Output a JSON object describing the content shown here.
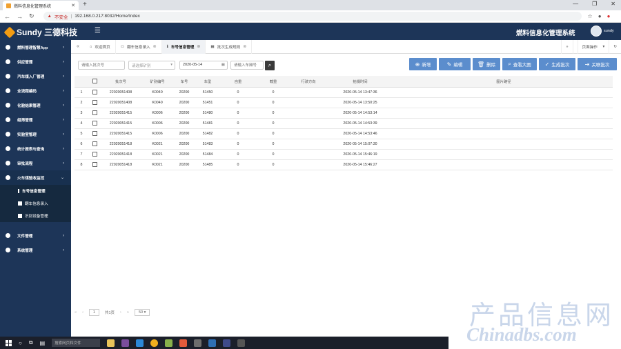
{
  "browser": {
    "tab_title": "燃料信息化管理系统",
    "insecure_label": "不安全",
    "url": "192.168.0.217:8032/Home/Index"
  },
  "header": {
    "brand": "Sundy 三德科技",
    "system_title": "燃料信息化管理系统",
    "user_name": "sundy"
  },
  "sidebar": {
    "items": [
      {
        "label": "燃料管理智慧App",
        "icon": "circle-icon"
      },
      {
        "label": "供应管理",
        "icon": "truck-icon"
      },
      {
        "label": "汽车煤入厂管理",
        "icon": "car-icon"
      },
      {
        "label": "全流程编码",
        "icon": "barcode-icon"
      },
      {
        "label": "化验结果管理",
        "icon": "list-icon"
      },
      {
        "label": "组筛管理",
        "icon": "filter-icon"
      },
      {
        "label": "实验室管理",
        "icon": "home-icon"
      },
      {
        "label": "统计报表与查询",
        "icon": "chart-icon"
      },
      {
        "label": "审批流程",
        "icon": "flag-icon"
      },
      {
        "label": "火车煤验收监控",
        "icon": "train-icon"
      }
    ],
    "subitems": [
      {
        "label": "车号信息管理"
      },
      {
        "label": "翻车信息录入"
      },
      {
        "label": "识别设备管理"
      }
    ],
    "bottom_items": [
      {
        "label": "文件管理",
        "icon": "file-icon"
      },
      {
        "label": "系统管理",
        "icon": "gear-icon"
      }
    ]
  },
  "tabs": {
    "items": [
      {
        "label": "欢迎首页"
      },
      {
        "label": "翻车信息录入"
      },
      {
        "label": "车号信息管理"
      },
      {
        "label": "批次生成规则"
      }
    ],
    "page_ops": "页面操作"
  },
  "toolbar": {
    "batch_placeholder": "请输入批次号",
    "mine_placeholder": "请选择矿别",
    "date_value": "2020-05-14",
    "car_placeholder": "请输入车厢号",
    "buttons": {
      "add": "新增",
      "edit": "编辑",
      "delete": "删除",
      "view_image": "查看大图",
      "gen_batch": "生成批次",
      "link_batch": "关联批次"
    }
  },
  "table": {
    "columns": [
      "批次号",
      "矿别编号",
      "车号",
      "车型",
      "自重",
      "载重",
      "行驶方向",
      "拍摄时间",
      "图片路径"
    ],
    "rows": [
      {
        "n": "1",
        "batch": "22020051408",
        "mine": "K0040",
        "car": "20200",
        "type": "51450",
        "tare": "0",
        "load": "0",
        "dir": "",
        "time": "2020-05-14 13:47:36",
        "path": ""
      },
      {
        "n": "2",
        "batch": "22020051408",
        "mine": "K0040",
        "car": "20200",
        "type": "51451",
        "tare": "0",
        "load": "0",
        "dir": "",
        "time": "2020-05-14 13:50:25",
        "path": ""
      },
      {
        "n": "3",
        "batch": "22020051415",
        "mine": "K0006",
        "car": "20200",
        "type": "51480",
        "tare": "0",
        "load": "0",
        "dir": "",
        "time": "2020-05-14 14:53:14",
        "path": ""
      },
      {
        "n": "4",
        "batch": "22020051415",
        "mine": "K0006",
        "car": "20200",
        "type": "51481",
        "tare": "0",
        "load": "0",
        "dir": "",
        "time": "2020-05-14 14:53:39",
        "path": ""
      },
      {
        "n": "5",
        "batch": "22020051415",
        "mine": "K0006",
        "car": "20200",
        "type": "51482",
        "tare": "0",
        "load": "0",
        "dir": "",
        "time": "2020-05-14 14:53:46",
        "path": ""
      },
      {
        "n": "6",
        "batch": "22020051418",
        "mine": "K0021",
        "car": "20200",
        "type": "51483",
        "tare": "0",
        "load": "0",
        "dir": "",
        "time": "2020-05-14 15:07:30",
        "path": ""
      },
      {
        "n": "7",
        "batch": "22020051418",
        "mine": "K0021",
        "car": "20200",
        "type": "51484",
        "tare": "0",
        "load": "0",
        "dir": "",
        "time": "2020-05-14 15:46:19",
        "path": ""
      },
      {
        "n": "8",
        "batch": "22020051418",
        "mine": "K0021",
        "car": "20200",
        "type": "51485",
        "tare": "0",
        "load": "0",
        "dir": "",
        "time": "2020-05-14 15:46:27",
        "path": ""
      }
    ]
  },
  "pager": {
    "page": "1",
    "total": "共1页",
    "page_size": "50"
  },
  "taskbar": {
    "search_placeholder": "搜索网页和文件"
  },
  "watermark": {
    "line1": "产品信息网",
    "line2": "Chinadbs.com"
  },
  "colors": {
    "nav_bg": "#1d3558",
    "button_blue": "#5b8dcd",
    "brand_orange": "#f39c12"
  }
}
